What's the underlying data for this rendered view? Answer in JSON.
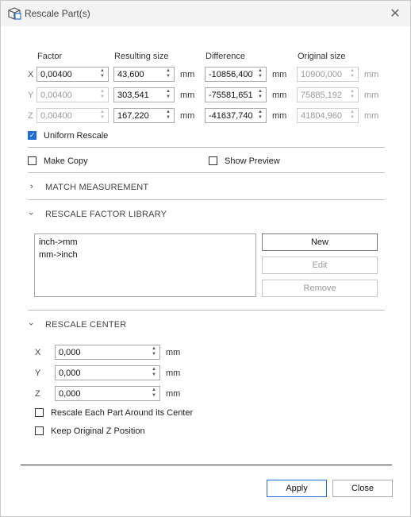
{
  "window": {
    "title": "Rescale Part(s)",
    "icon": "cube-scale-icon",
    "close_icon": "close-icon"
  },
  "columns": {
    "factor": "Factor",
    "resulting": "Resulting size",
    "difference": "Difference",
    "original": "Original size"
  },
  "rows": [
    {
      "axis": "X",
      "factor": "0,00400",
      "resulting": "43,600",
      "difference": "-10856,400",
      "original": "10900,000",
      "unit": "mm"
    },
    {
      "axis": "Y",
      "factor": "0,00400",
      "resulting": "303,541",
      "difference": "-75581,651",
      "original": "75885,192",
      "unit": "mm"
    },
    {
      "axis": "Z",
      "factor": "0,00400",
      "resulting": "167,220",
      "difference": "-41637,740",
      "original": "41804,960",
      "unit": "mm"
    }
  ],
  "uniform_rescale": {
    "label": "Uniform Rescale",
    "checked": true
  },
  "make_copy": {
    "label": "Make Copy",
    "checked": false
  },
  "show_preview": {
    "label": "Show Preview",
    "checked": false
  },
  "sections": {
    "match": "MATCH MEASUREMENT",
    "library": "RESCALE FACTOR LIBRARY",
    "center": "RESCALE CENTER"
  },
  "library": {
    "items": [
      "inch->mm",
      "mm->inch"
    ],
    "new": "New",
    "edit": "Edit",
    "remove": "Remove"
  },
  "center": {
    "x": {
      "axis": "X",
      "value": "0,000",
      "unit": "mm"
    },
    "y": {
      "axis": "Y",
      "value": "0,000",
      "unit": "mm"
    },
    "z": {
      "axis": "Z",
      "value": "0,000",
      "unit": "mm"
    },
    "each_part": {
      "label": "Rescale Each Part Around its Center",
      "checked": false
    },
    "keep_z": {
      "label": "Keep Original Z Position",
      "checked": false
    }
  },
  "footer": {
    "apply": "Apply",
    "close": "Close"
  }
}
